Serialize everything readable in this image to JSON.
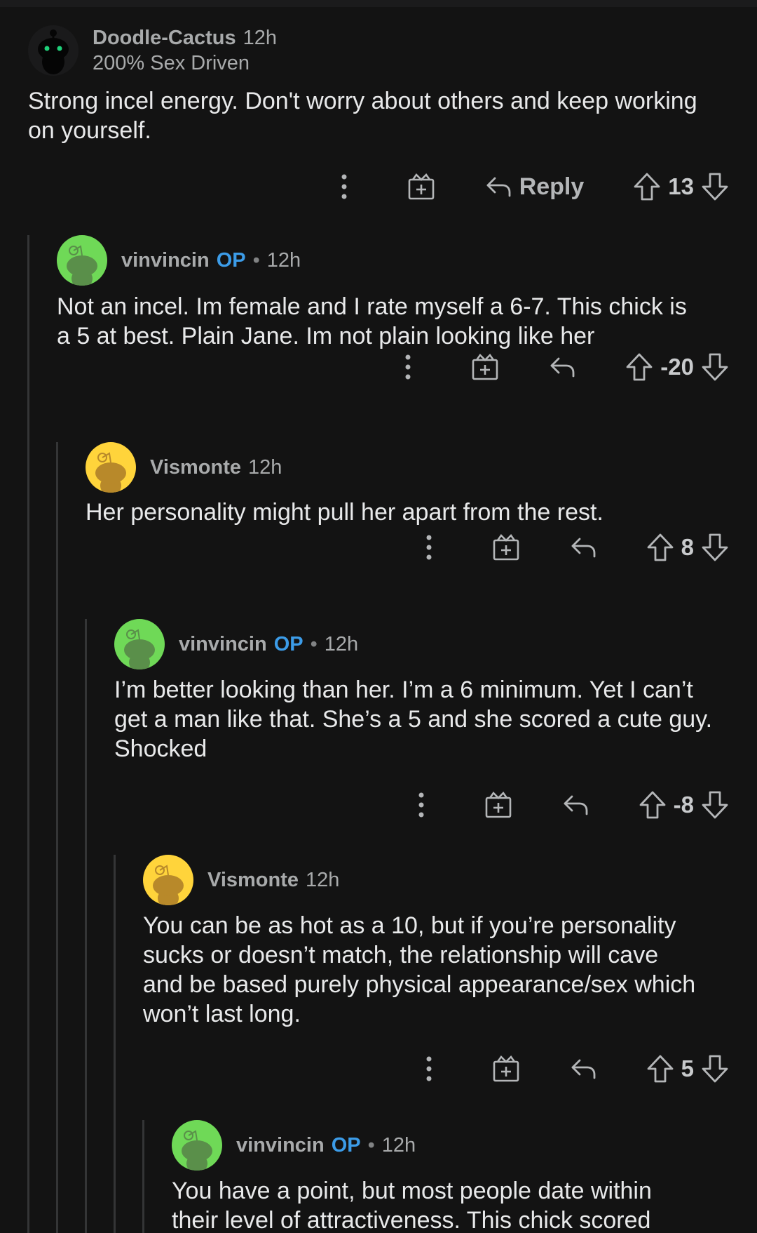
{
  "comments": [
    {
      "username": "Doodle-Cactus",
      "time": "12h",
      "flair": "200% Sex Driven",
      "body": "Strong incel energy. Don't worry about others and keep working\non yourself.",
      "reply_label": "Reply",
      "score": "13",
      "avatar_color": "#1a1a1b"
    },
    {
      "username": "vinvincin",
      "op": "OP",
      "dot": "•",
      "time": "12h",
      "body": "Not an incel. Im female and I rate myself a 6-7. This chick is\na 5 at best. Plain Jane. Im not plain looking like her",
      "score": "-20",
      "avatar_color": "#6fd957"
    },
    {
      "username": "Vismonte",
      "time": "12h",
      "body": "Her personality might pull her apart from the rest.",
      "score": "8",
      "avatar_color": "#ffd43b"
    },
    {
      "username": "vinvincin",
      "op": "OP",
      "dot": "•",
      "time": "12h",
      "body": "I’m better looking than her. I’m a 6 minimum. Yet I can’t\nget a man like that. She’s a 5 and she scored a cute guy.\nShocked",
      "score": "-8",
      "avatar_color": "#6fd957"
    },
    {
      "username": "Vismonte",
      "time": "12h",
      "body": "You can be as hot as a 10, but if you’re personality\nsucks or doesn’t match, the relationship will cave\nand be based purely physical appearance/sex which\nwon’t last long.",
      "score": "5",
      "avatar_color": "#ffd43b"
    },
    {
      "username": "vinvincin",
      "op": "OP",
      "dot": "•",
      "time": "12h",
      "body": "You have a point, but most people date within\ntheir level of attractiveness. This chick scored",
      "avatar_color": "#6fd957"
    }
  ],
  "icons": {
    "more": "more-options-icon",
    "award": "award-icon",
    "reply": "reply-icon",
    "upvote": "upvote-arrow-icon",
    "downvote": "downvote-arrow-icon"
  },
  "colors": {
    "background": "#131313",
    "op_badge": "#3c9ce8",
    "thread_line": "#343536"
  }
}
